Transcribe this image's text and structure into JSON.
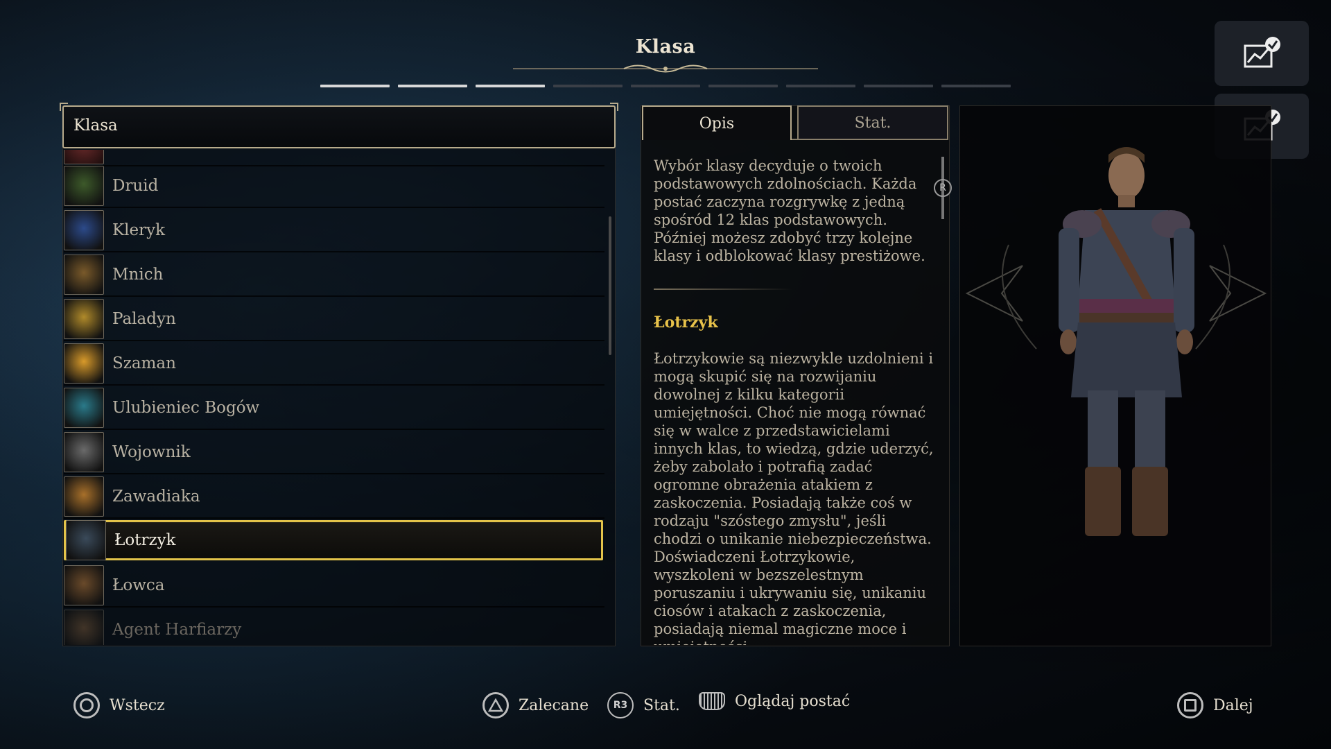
{
  "header": {
    "title": "Klasa"
  },
  "progress": {
    "total": 9,
    "completed": 3
  },
  "top_right_buttons": [
    {
      "icon": "chart-check-icon"
    },
    {
      "icon": "chart-check-icon"
    }
  ],
  "class_list": {
    "header": "Klasa",
    "items": [
      {
        "label": "Druid",
        "color": "#3d5a2a"
      },
      {
        "label": "Kleryk",
        "color": "#2c4a8a"
      },
      {
        "label": "Mnich",
        "color": "#7a5a2a"
      },
      {
        "label": "Paladyn",
        "color": "#b08a2a"
      },
      {
        "label": "Szaman",
        "color": "#d89a2a"
      },
      {
        "label": "Ulubieniec Bogów",
        "color": "#2a7a8a"
      },
      {
        "label": "Wojownik",
        "color": "#6a6a6a"
      },
      {
        "label": "Zawadiaka",
        "color": "#a8702a"
      },
      {
        "label": "Łotrzyk",
        "color": "#3a4a5a",
        "selected": true
      },
      {
        "label": "Łowca",
        "color": "#6a4a2a"
      },
      {
        "label": "Agent Harfiarzy",
        "color": "#7a5a3a",
        "faded": true
      }
    ]
  },
  "description": {
    "tabs": [
      "Opis",
      "Stat."
    ],
    "active_tab": "Opis",
    "intro": "Wybór klasy decyduje o twoich podstawowych zdolnościach. Każda postać zaczyna rozgrywkę z jedną spośród 12 klas podstawowych. Później możesz zdobyć trzy kolejne klasy i odblokować klasy prestiżowe.",
    "class_name": "Łotrzyk",
    "class_text": "Łotrzykowie są niezwykle uzdolnieni i mogą skupić się na rozwijaniu dowolnej z kilku kategorii umiejętności. Choć nie mogą równać się w walce z przedstawicielami innych klas, to wiedzą, gdzie uderzyć, żeby zabolało i potrafią zadać ogromne obrażenia atakiem z zaskoczenia. Posiadają także coś w rodzaju \"szóstego zmysłu\", jeśli chodzi o unikanie niebezpieczeństwa. Doświadczeni Łotrzykowie, wyszkoleni w bezszelestnym poruszaniu i ukrywaniu się, unikaniu ciosów i atakach z zaskoczenia, posiadają niemal magiczne moce i umiejętności.",
    "scroll_hint": "R"
  },
  "footer": {
    "back": "Wstecz",
    "recommended": "Zalecane",
    "r3": "R3",
    "stats": "Stat.",
    "view_character": "Oglądaj postać",
    "next": "Dalej"
  },
  "accent_color": "#e3c34a"
}
